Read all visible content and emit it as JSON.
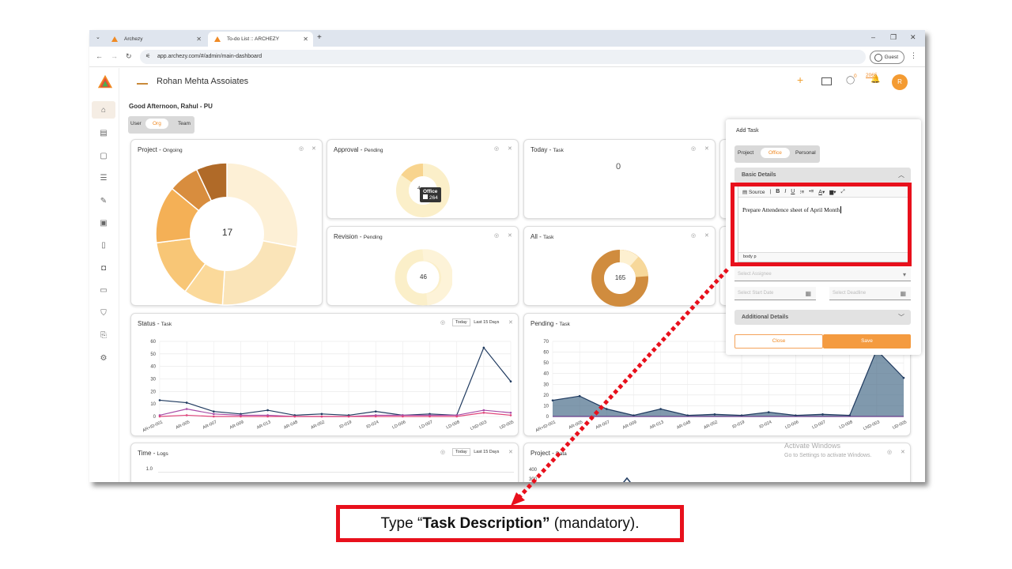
{
  "browser": {
    "tabs": [
      {
        "label": "Archezy",
        "active": false
      },
      {
        "label": "To-do List :: ARCHEZY",
        "active": true
      }
    ],
    "url": "app.archezy.com/#/admin/main-dashboard",
    "profile": "Guest"
  },
  "header": {
    "logo_text": "ARCHEZY",
    "company": "Rohan Mehta Assoiates",
    "notif_chat": "0",
    "notif_bell": "2065",
    "avatar": "R"
  },
  "greeting": "Good Afternoon, Rahul - PU",
  "scope_tabs": {
    "options": [
      "User",
      "Org",
      "Team"
    ],
    "selected": "Org"
  },
  "cards": {
    "project": {
      "title": "Project",
      "sub": "Ongoing",
      "center": "17"
    },
    "approval": {
      "title": "Approval",
      "sub": "Pending",
      "tooltip_label": "Office",
      "tooltip_value": "264",
      "partial": "4"
    },
    "today": {
      "title": "Today",
      "sub": "Task",
      "value": "0"
    },
    "revision": {
      "title": "Revision",
      "sub": "Pending",
      "center": "46"
    },
    "all": {
      "title": "All",
      "sub": "Task",
      "center": "165"
    },
    "status": {
      "title": "Status",
      "sub": "Task",
      "seg_today": "Today",
      "seg_15": "Last 15 Days"
    },
    "pending": {
      "title": "Pending",
      "sub": "Task"
    },
    "time": {
      "title": "Time",
      "sub": "Logs",
      "seg_today": "Today",
      "seg_15": "Last 15 Days",
      "ytick": "1.0"
    },
    "projectdata": {
      "title": "Project",
      "sub": "Data",
      "yticks": [
        "400",
        "300"
      ]
    }
  },
  "chart_data": [
    {
      "type": "line",
      "title": "Status - Task",
      "categories": [
        "AR+ID-001",
        "AR-005",
        "AR-007",
        "AR-009",
        "AR-013",
        "AR-048",
        "AR-052",
        "ID-019",
        "ID-024",
        "LD-006",
        "LD-007",
        "LD-008",
        "LND-003",
        "UD-005"
      ],
      "ylim": [
        0,
        60
      ],
      "yticks": [
        "60",
        "50",
        "40",
        "30",
        "20",
        "10",
        "0"
      ],
      "series": [
        {
          "values": [
            13,
            11,
            4,
            2,
            5,
            1,
            2,
            1,
            4,
            1,
            2,
            1,
            55,
            28
          ],
          "color": "#1f3a5f"
        },
        {
          "values": [
            1,
            6,
            2,
            1,
            1,
            0,
            0,
            0,
            1,
            1,
            1,
            1,
            5,
            3
          ],
          "color": "#a64ca6"
        },
        {
          "values": [
            0,
            1,
            0,
            0,
            0,
            0,
            0,
            0,
            0,
            0,
            0,
            0,
            3,
            1
          ],
          "color": "#e0457b"
        }
      ]
    },
    {
      "type": "area",
      "title": "Pending - Task",
      "categories": [
        "AR+ID-001",
        "AR-005",
        "AR-007",
        "AR-009",
        "AR-013",
        "AR-048",
        "AR-052",
        "ID-019",
        "ID-024",
        "LD-006",
        "LD-007",
        "LD-008",
        "LND-003",
        "UD-005"
      ],
      "ylim": [
        0,
        70
      ],
      "yticks": [
        "70",
        "60",
        "50",
        "40",
        "30",
        "20",
        "10",
        "0"
      ],
      "series": [
        {
          "values": [
            15,
            19,
            7,
            1,
            7,
            1,
            2,
            1,
            4,
            1,
            2,
            1,
            62,
            36
          ],
          "color": "#4a6d8a"
        }
      ]
    }
  ],
  "add_task": {
    "title": "Add Task",
    "tabs": [
      "Project",
      "Office",
      "Personal"
    ],
    "selected_tab": "Office",
    "basic": "Basic Details",
    "toolbar_source": "Source",
    "description": "Prepare Attendence sheet of April Month",
    "footer_path": "body  p",
    "assignee_ph": "Select Assignee",
    "start_ph": "Select Start Date",
    "deadline_ph": "Select Deadline",
    "additional": "Additional Details",
    "close": "Close",
    "save": "Save"
  },
  "watermark": {
    "line1": "Activate Windows",
    "line2": "Go to Settings to activate Windows."
  },
  "callout": {
    "pre": "Type “",
    "bold": "Task Description”",
    "post": " (mandatory)."
  }
}
